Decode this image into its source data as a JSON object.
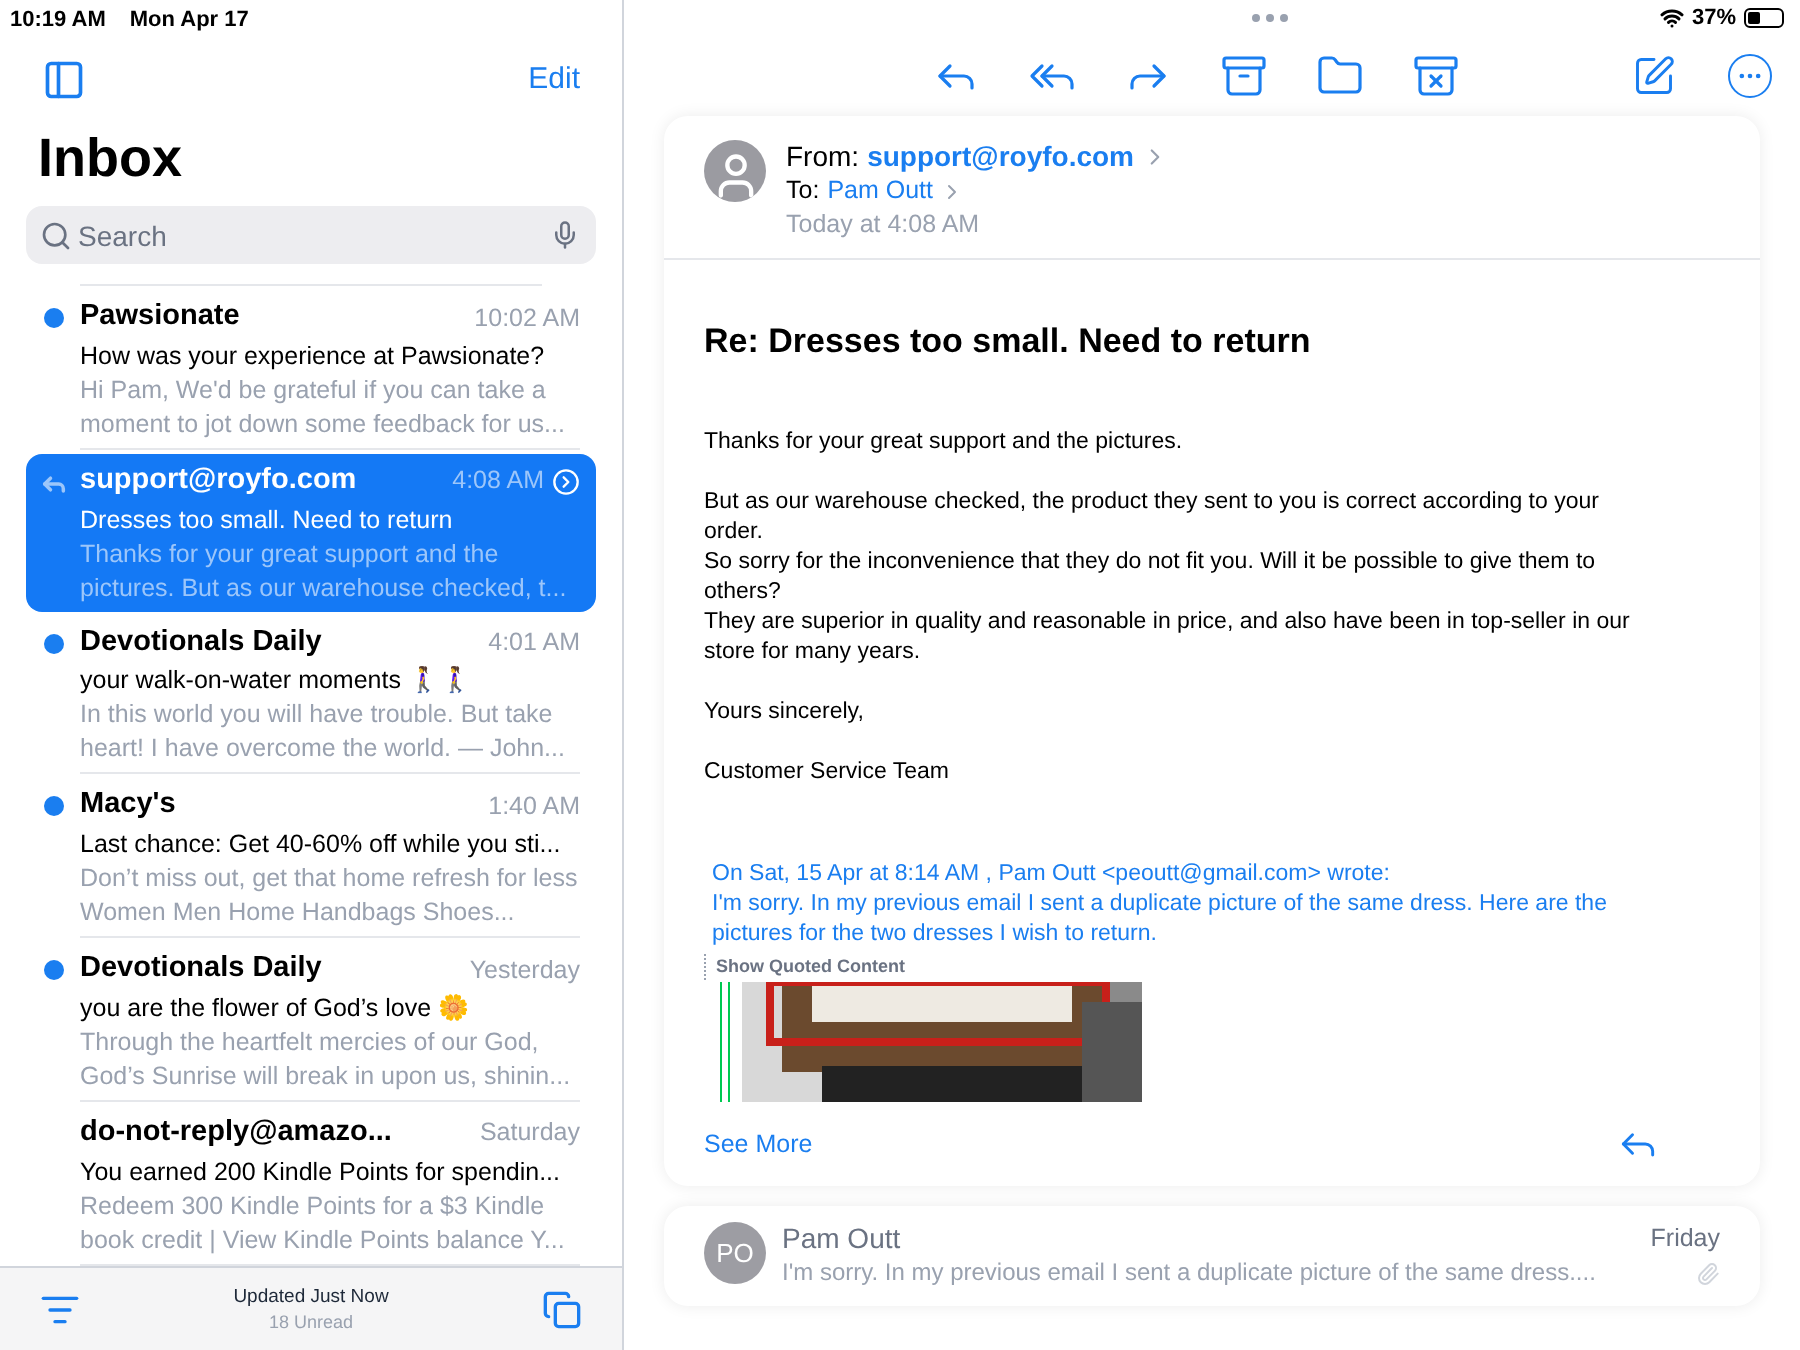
{
  "status_bar": {
    "time": "10:19 AM",
    "date": "Mon Apr 17",
    "battery_text": "37%",
    "battery": {
      "level": 0.37
    }
  },
  "sidebar": {
    "edit": "Edit",
    "title": "Inbox",
    "search": {
      "placeholder": "Search"
    },
    "messages": [
      {
        "sender": "Pawsionate",
        "time": "10:02 AM",
        "subject": "How was your experience at Pawsionate?",
        "preview": "Hi Pam, We'd be grateful if you can take a moment to jot down some feedback for us...",
        "unread": true,
        "replied": false,
        "selected": false
      },
      {
        "sender": "support@royfo.com",
        "time": "4:08 AM",
        "subject": "Dresses too small. Need to return",
        "preview": "Thanks for your great support and the pictures. But as our warehouse checked, t...",
        "unread": false,
        "replied": true,
        "selected": true
      },
      {
        "sender": "Devotionals Daily",
        "time": "4:01 AM",
        "subject": "your walk-on-water moments 🚶‍♀️🚶‍♀️",
        "preview": "In this world you will have trouble. But take heart! I have overcome the world. — John...",
        "unread": true,
        "replied": false,
        "selected": false
      },
      {
        "sender": "Macy's",
        "time": "1:40 AM",
        "subject": "Last chance: Get 40-60% off while you sti...",
        "preview": "Don’t miss out, get that home refresh for less Women Men Home Handbags Shoes...",
        "unread": true,
        "replied": false,
        "selected": false
      },
      {
        "sender": "Devotionals Daily",
        "time": "Yesterday",
        "subject": "you are the flower of God’s love 🌼",
        "preview": "Through the heartfelt mercies of our God, God’s Sunrise will break in upon us, shinin...",
        "unread": true,
        "replied": false,
        "selected": false
      },
      {
        "sender": "do-not-reply@amazo...",
        "time": "Saturday",
        "subject": "You earned 200 Kindle Points for spendin...",
        "preview": "Redeem 300 Kindle Points for a $3 Kindle book credit | View Kindle Points balance Y...",
        "unread": false,
        "replied": false,
        "selected": false
      }
    ],
    "footer": {
      "updated": "Updated Just Now",
      "unread": "18 Unread"
    }
  },
  "message": {
    "from_label": "From:",
    "from": "support@royfo.com",
    "to_label": "To:",
    "to": "Pam Outt",
    "date": "Today at 4:08 AM",
    "subject": "Re: Dresses too small. Need to return",
    "body": [
      "Thanks for your great support and the pictures.",
      "But as our warehouse checked, the product they sent to you is correct according to your order.\nSo sorry for the inconvenience that they do not fit you. Will it be possible to give them to others?\nThey are superior in quality and reasonable in price, and also have been in top-seller in our store for many years.",
      "Yours sincerely,",
      "Customer Service Team"
    ],
    "quote_header": "On Sat, 15 Apr at 8:14 AM , Pam Outt <peoutt@gmail.com> wrote:",
    "quote_text": "I'm sorry. In my previous email I sent a duplicate picture of the same dress. Here are the pictures for the two dresses I wish to return.",
    "show_quoted": "Show Quoted Content",
    "see_more": "See More"
  },
  "previous": {
    "initials": "PO",
    "sender": "Pam Outt",
    "time": "Friday",
    "preview": "I'm sorry. In my previous email I sent a duplicate picture of the same dress....",
    "attachment": true
  }
}
